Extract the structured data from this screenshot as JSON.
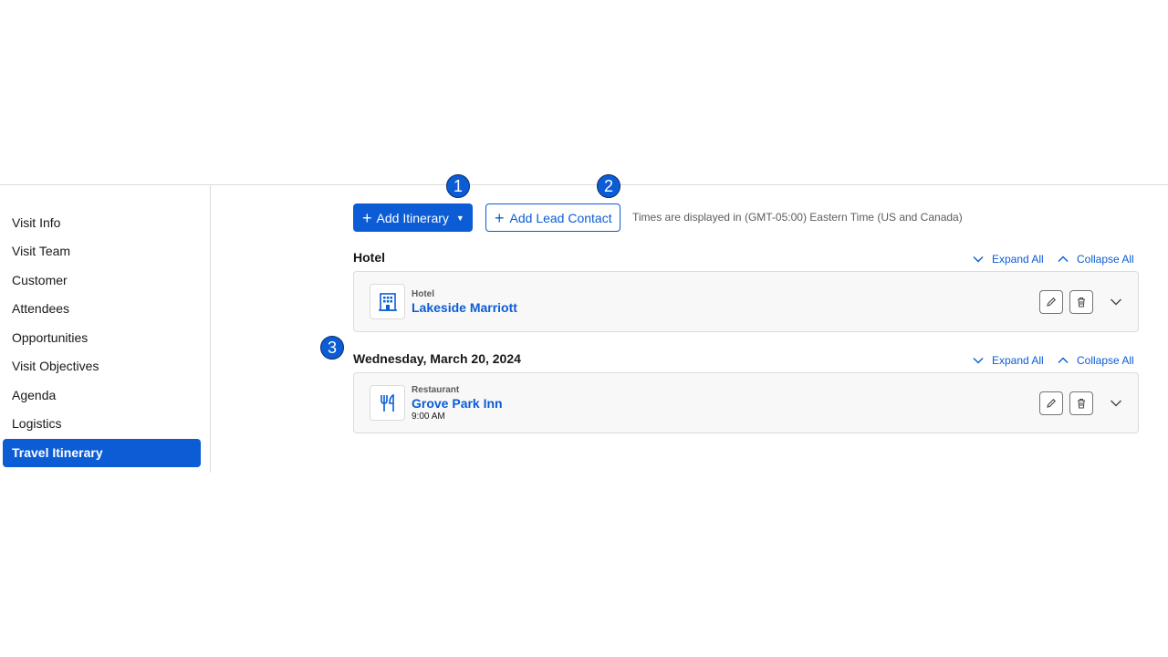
{
  "sidebar": {
    "items": [
      {
        "label": "Visit Info"
      },
      {
        "label": "Visit Team"
      },
      {
        "label": "Customer"
      },
      {
        "label": "Attendees"
      },
      {
        "label": "Opportunities"
      },
      {
        "label": "Visit Objectives"
      },
      {
        "label": "Agenda"
      },
      {
        "label": "Logistics"
      },
      {
        "label": "Travel Itinerary",
        "active": true
      }
    ]
  },
  "toolbar": {
    "add_itinerary_label": "Add Itinerary",
    "add_lead_contact_label": "Add Lead Contact",
    "timezone_note": "Times are displayed in (GMT-05:00) Eastern Time (US and Canada)"
  },
  "callouts": [
    "1",
    "2",
    "3"
  ],
  "sections": [
    {
      "title": "Hotel",
      "expand_all": "Expand All",
      "collapse_all": "Collapse All",
      "card": {
        "icon": "hotel-icon",
        "type": "Hotel",
        "name": "Lakeside Marriott"
      }
    },
    {
      "title": "Wednesday, March 20, 2024",
      "expand_all": "Expand All",
      "collapse_all": "Collapse All",
      "card": {
        "icon": "restaurant-icon",
        "type": "Restaurant",
        "name": "Grove Park Inn",
        "time": "9:00 AM"
      }
    }
  ],
  "colors": {
    "accent": "#0b5cd5",
    "border": "#dddbda",
    "card_bg": "#f8f8f8"
  }
}
